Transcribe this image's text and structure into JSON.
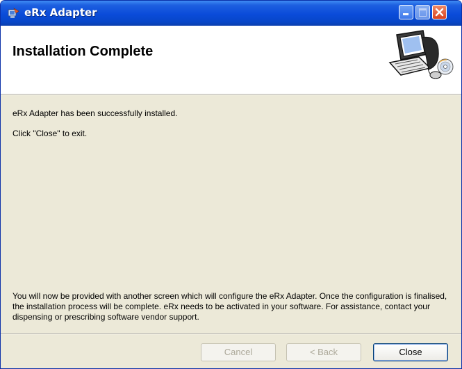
{
  "window": {
    "title": "eRx Adapter",
    "icon": "installer-icon"
  },
  "header": {
    "title": "Installation Complete",
    "art": "computer-setup-illustration"
  },
  "content": {
    "line1": "eRx Adapter has been successfully installed.",
    "line2": "Click \"Close\" to exit.",
    "info": "You will now be provided with another screen which will configure the eRx Adapter. Once the configuration is finalised, the installation process will be complete. eRx needs to be activated in your software. For assistance, contact your dispensing or prescribing software vendor support."
  },
  "buttons": {
    "cancel": "Cancel",
    "back": "< Back",
    "close": "Close"
  },
  "colors": {
    "titlebar": "#0a4bd9",
    "dialog_bg": "#ece9d8",
    "close_red": "#d9421f"
  }
}
